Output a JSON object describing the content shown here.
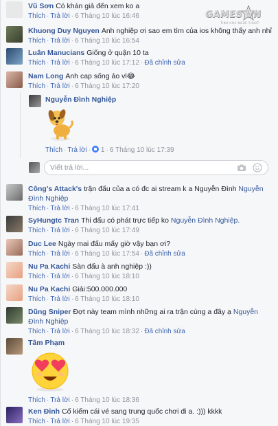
{
  "logo": {
    "text": "GAMES VN",
    "tagline": "TINH HOA NGHE THUAT"
  },
  "actions": {
    "like": "Thích",
    "reply": "Trả lời",
    "edited": "Đã chỉnh sửa"
  },
  "comments": [
    {
      "author": "Vũ Sơn",
      "text": "Có khán giả đến xem ko a",
      "time": "6 Tháng 10 lúc 16:46",
      "edited": false
    },
    {
      "author": "Khuong Duy Nguyen",
      "text": "Anh nghiệp ơi sao em tìm của ios không thấy anh nhỉ",
      "time": "6 Tháng 10 lúc 16:54",
      "edited": false
    },
    {
      "author": "Luân Manucians",
      "text": "Giống ở quận 10 ta",
      "time": "6 Tháng 10 lúc 17:12",
      "edited": true
    },
    {
      "author": "Nam Long",
      "text": "Anh cap sống ảo vl😂",
      "time": "6 Tháng 10 lúc 17:20",
      "edited": false
    },
    {
      "author": "Công's Attack's",
      "text": "trận đấu của a có đc ai stream k a Nguyễn Đình",
      "mention": "Nguyễn Đình Nghiệp",
      "time": "6 Tháng 10 lúc 17:41",
      "edited": false
    },
    {
      "author": "SyHungtc Tran",
      "text": "Thi đấu có phát trực tiếp ko",
      "mention": "Nguyễn Đình Nghiệp.",
      "time": "6 Tháng 10 lúc 17:49",
      "edited": false
    },
    {
      "author": "Duc Lee",
      "text": "Ngày mai đấu mấy giờ vậy bạn ơi?",
      "time": "6 Tháng 10 lúc 17:54",
      "edited": true
    },
    {
      "author": "Nu Pa Kachi",
      "text": "Sàn đấu à anh nghiệp :))",
      "time": "6 Tháng 10 lúc 18:10",
      "edited": false
    },
    {
      "author": "Nu Pa Kachi",
      "text": "Giải:500.000.000",
      "time": "6 Tháng 10 lúc 18:10",
      "edited": false
    },
    {
      "author": "Dũng Sniper",
      "text": "Đợt này team mình những ai ra trận cùng a đây ạ",
      "mention": "Nguyễn Đình Nghiệp",
      "time": "6 Tháng 10 lúc 18:32",
      "edited": true
    },
    {
      "author": "Tâm Phạm",
      "text": "",
      "time": "6 Tháng 10 lúc 18:36",
      "edited": false
    },
    {
      "author": "Ken Đinh",
      "text": "Cố kiếm cái vé sang trung quốc chơi đi a. :))) kkkk",
      "time": "6 Tháng 10 lúc 19:35",
      "edited": false
    }
  ],
  "reply": {
    "author": "Nguyễn Đình Nghiệp",
    "reaction_count": "1",
    "time": "6 Tháng 10 lúc 17:39"
  },
  "reply_box": {
    "placeholder": "Viết trả lời..."
  }
}
